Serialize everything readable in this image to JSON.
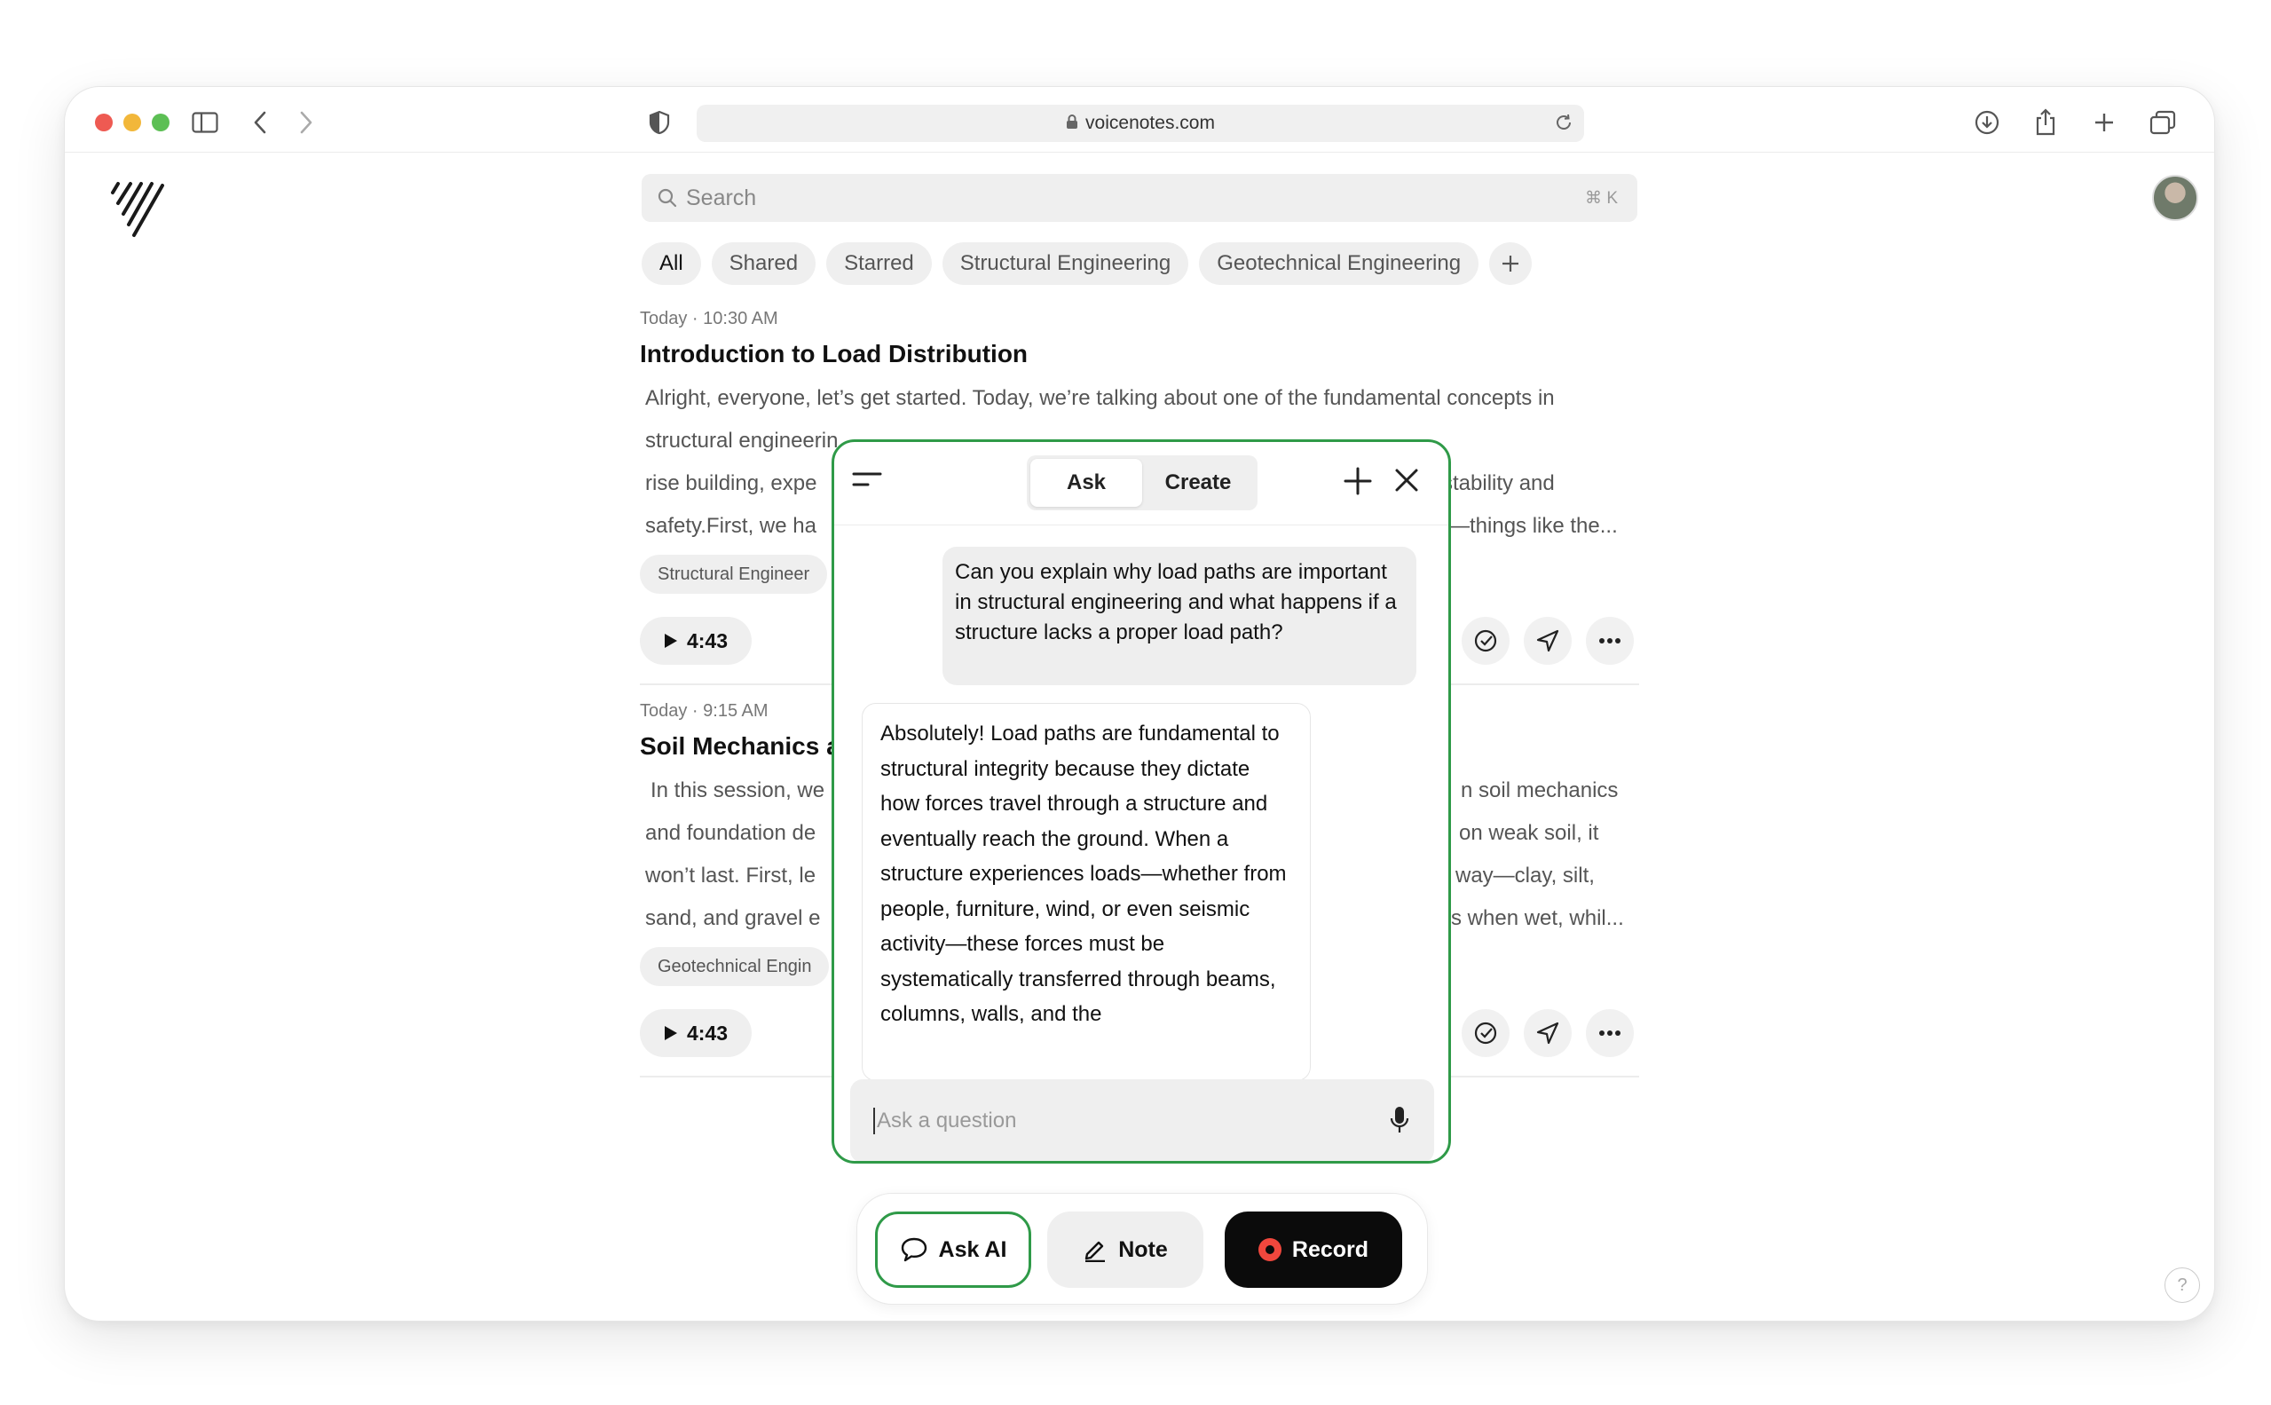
{
  "browser": {
    "url": "voicenotes.com"
  },
  "search": {
    "placeholder": "Search",
    "shortcut": "⌘ K"
  },
  "filters": [
    "All",
    "Shared",
    "Starred",
    "Structural Engineering",
    "Geotechnical Engineering"
  ],
  "notes": [
    {
      "meta": "Today  · 10:30 AM",
      "title": "Introduction to Load Distribution",
      "body": [
        "Alright, everyone, let’s get started. Today, we’re talking about one of the fundamental concepts in",
        "structural engineerin",
        "rise building, expe",
        "safety.First, we ha"
      ],
      "body_right": [
        "",
        "",
        "stability and",
        "—things like the..."
      ],
      "tag": "Structural Engineer",
      "duration": "4:43"
    },
    {
      "meta": "Today · 9:15 AM",
      "title": "Soil Mechanics a",
      "body": [
        "In this session, we",
        "and foundation de",
        "won’t last. First, le",
        "sand, and gravel e"
      ],
      "body_right": [
        "n soil mechanics",
        "on weak soil, it",
        "way—clay, silt,",
        "s when wet, whil..."
      ],
      "tag": "Geotechnical Engin",
      "duration": "4:43"
    }
  ],
  "ask_panel": {
    "tabs": [
      "Ask",
      "Create"
    ],
    "active_tab": "Ask",
    "user_message": "Can you explain why load paths are important in structural engineering and what happens if a structure lacks a proper load path?",
    "ai_message": "Absolutely! Load paths are fundamental to structural integrity because they dictate how forces travel through a structure and eventually reach the ground. When a structure experiences loads—whether from people, furniture, wind, or even seismic activity—these forces must be systematically transferred through beams, columns, walls, and the",
    "input_placeholder": "Ask a question"
  },
  "bottom_bar": {
    "ask_ai": "Ask AI",
    "note": "Note",
    "record": "Record"
  },
  "help": "?",
  "colors": {
    "accent_green": "#2f9a48",
    "record_red": "#f0473d"
  }
}
